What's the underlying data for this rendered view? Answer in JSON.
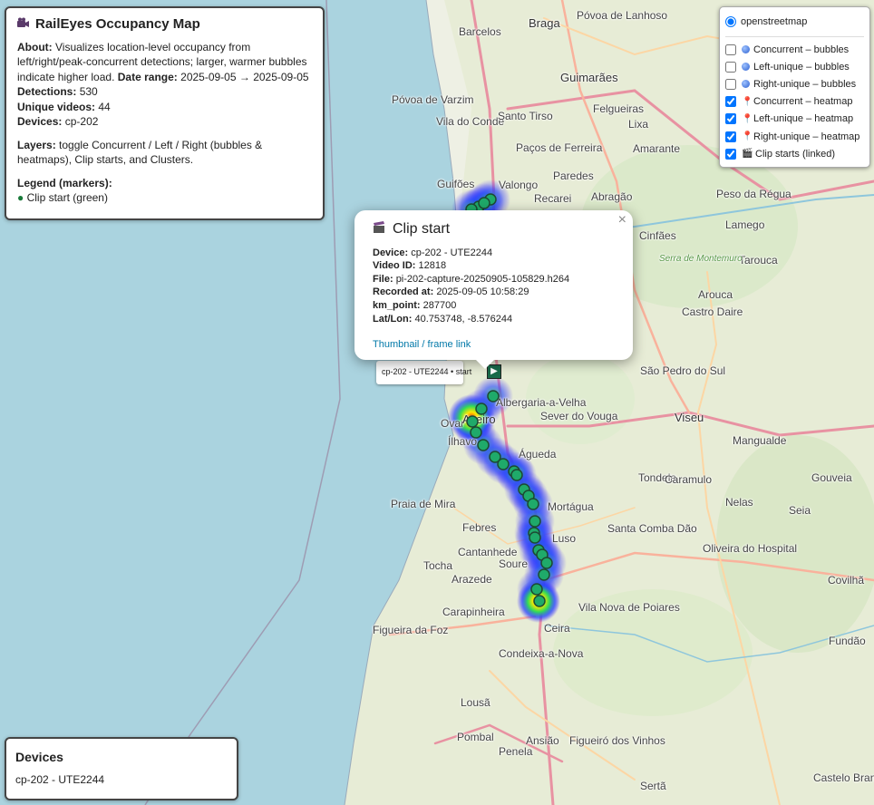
{
  "info": {
    "title": "RailEyes Occupancy Map",
    "about_label": "About:",
    "about_text": "Visualizes location-level occupancy from left/right/peak-concurrent detections; larger, warmer bubbles indicate higher load.",
    "date_label": "Date range:",
    "date_value": "2025-09-05 → 2025-09-05",
    "detections_label": "Detections:",
    "detections_value": "530",
    "videos_label": "Unique videos:",
    "videos_value": "44",
    "devices_label": "Devices:",
    "devices_value": "cp-202",
    "layers_label": "Layers:",
    "layers_text": "toggle Concurrent / Left / Right (bubbles & heatmaps), Clip starts, and Clusters.",
    "legend_label": "Legend (markers):",
    "legend_item": "Clip start (green)"
  },
  "devices_panel": {
    "title": "Devices",
    "item": "cp-202 - UTE2244"
  },
  "layers": {
    "base": "openstreetmap",
    "overlays": [
      {
        "label": "Concurrent – bubbles",
        "checked": false,
        "icon": "bubble-icon"
      },
      {
        "label": "Left-unique – bubbles",
        "checked": false,
        "icon": "bubble-icon"
      },
      {
        "label": "Right-unique – bubbles",
        "checked": false,
        "icon": "bubble-icon"
      },
      {
        "label": "Concurrent – heatmap",
        "checked": true,
        "icon": "pin-icon"
      },
      {
        "label": "Left-unique – heatmap",
        "checked": true,
        "icon": "pin-icon"
      },
      {
        "label": "Right-unique – heatmap",
        "checked": true,
        "icon": "pin-icon"
      },
      {
        "label": "Clip starts (linked)",
        "checked": true,
        "icon": "clapper-icon"
      }
    ]
  },
  "popup": {
    "title": "Clip start",
    "device_label": "Device:",
    "device": "cp-202 - UTE2244",
    "video_label": "Video ID:",
    "video": "12818",
    "file_label": "File:",
    "file": "pi-202-capture-20250905-105829.h264",
    "recorded_label": "Recorded at:",
    "recorded": "2025-09-05 10:58:29",
    "km_label": "km_point:",
    "km": "287700",
    "latlon_label": "Lat/Lon:",
    "latlon": "40.753748, -8.576244",
    "link": "Thumbnail / frame link"
  },
  "tooltip": "cp-202 - UTE2244 • start",
  "places": [
    "Barcelos",
    "Braga",
    "Póvoa de Lanhoso",
    "Guimarães",
    "Póvoa de Varzim",
    "Vila do Conde",
    "Santo Tirso",
    "Felgueiras",
    "Lixa",
    "Amarante",
    "Paços de Ferreira",
    "Paredes",
    "Valongo",
    "Abragão",
    "Recarei",
    "Peso da Régua",
    "Lamego",
    "Tarouca",
    "Cinfães",
    "Castro Daire",
    "Albergaria-a-Velha",
    "Ílhavo",
    "Águeda",
    "Viseu",
    "Mangualde",
    "Tondela",
    "Santa Comba Dão",
    "Oliveira do Hospital",
    "Praia de Mira",
    "Febres",
    "Cantanhede",
    "Tocha",
    "Arazede",
    "Carapinheira",
    "Figueira da Foz",
    "Condeixa-a-Nova",
    "Lousã",
    "Ceira",
    "Penela",
    "Pombal",
    "Ansião",
    "Figueiró dos Vinhos",
    "Sertã",
    "Castelo Branco",
    "Fundão",
    "Covilhã",
    "Seia",
    "Gouveia",
    "Nelas",
    "São Pedro do Sul",
    "Vila Nova de Poiares",
    "Soure",
    "Guifões",
    "Arouca",
    "Ovar",
    "Aveiro",
    "Sever do Vouga",
    "Luso",
    "Mortágua",
    "Caramulo",
    "Serra de Montemuro"
  ],
  "colors": {
    "accent": "#0078a8",
    "sea": "#aad3df",
    "land": "#f2efe9",
    "track": "#1faa6a",
    "heat_core": "#ffe600"
  }
}
